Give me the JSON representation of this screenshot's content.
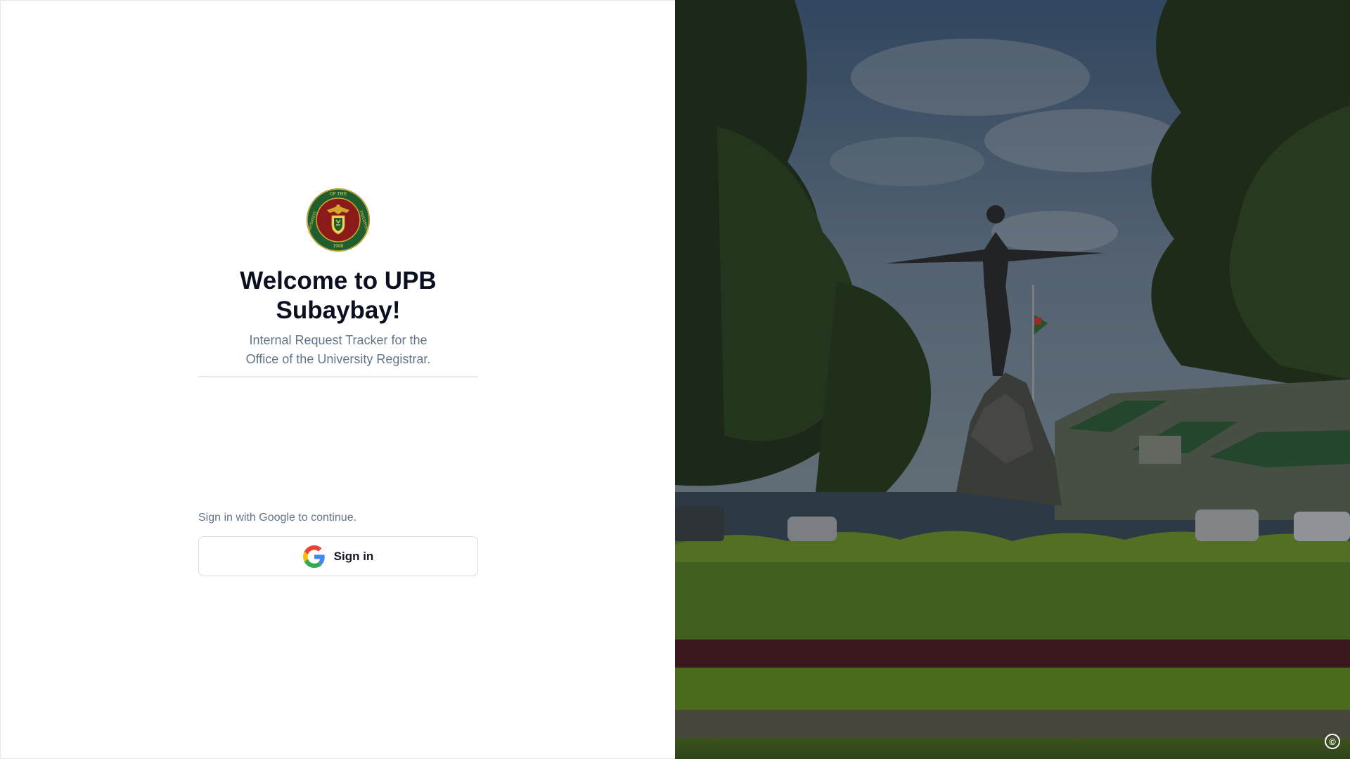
{
  "logo": {
    "name": "university-of-the-philippines-seal",
    "text_top": "OF THE",
    "text_left": "UNIVERSITY",
    "text_right": "PHILIPPINES",
    "year": "1908"
  },
  "welcome": {
    "title": "Welcome to UPB Subaybay!",
    "subtitle": "Internal Request Tracker for the Office of the University Registrar."
  },
  "signin": {
    "hint": "Sign in with Google to continue.",
    "button_label": "Sign in",
    "button_icon": "google-g-icon"
  },
  "background": {
    "image": "oblation-statue-campus-photo",
    "copyright_icon": "copyright-icon",
    "copyright_symbol": "©"
  },
  "colors": {
    "title": "#0b1020",
    "muted": "#64748b",
    "divider": "#e2e8f0",
    "seal_red": "#8b1a1a",
    "seal_green": "#1f5e2f",
    "seal_gold": "#d4a72c"
  }
}
